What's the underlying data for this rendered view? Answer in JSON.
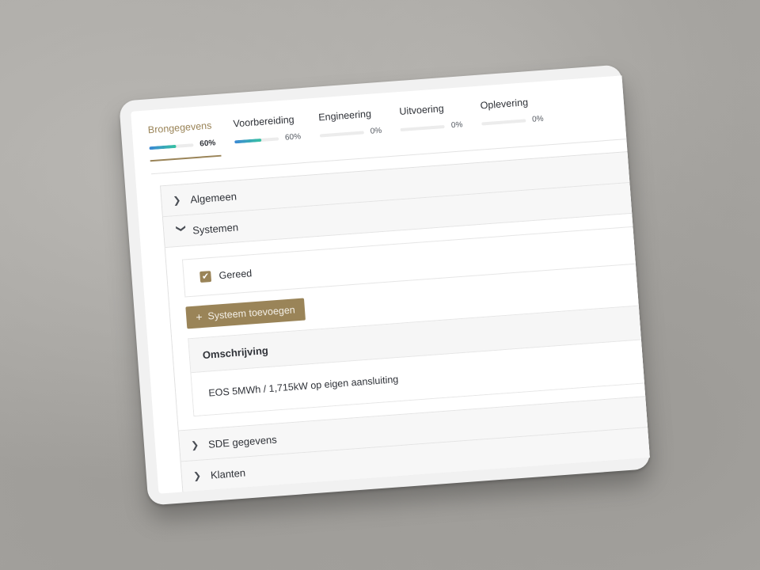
{
  "tabs": [
    {
      "label": "Brongegevens",
      "progress": 60,
      "progress_text": "60%",
      "active": true
    },
    {
      "label": "Voorbereiding",
      "progress": 60,
      "progress_text": "60%",
      "active": false
    },
    {
      "label": "Engineering",
      "progress": 0,
      "progress_text": "0%",
      "active": false
    },
    {
      "label": "Uitvoering",
      "progress": 0,
      "progress_text": "0%",
      "active": false
    },
    {
      "label": "Oplevering",
      "progress": 0,
      "progress_text": "0%",
      "active": false
    }
  ],
  "accordion": {
    "algemeen": {
      "title": "Algemeen",
      "expanded": false
    },
    "systemen": {
      "title": "Systemen",
      "expanded": true,
      "ready_label": "Gereed",
      "ready_checked": true,
      "add_button_label": "Systeem toevoegen",
      "table": {
        "header": "Omschrijving",
        "rows": [
          "EOS 5MWh / 1,715kW op eigen aansluiting"
        ]
      }
    },
    "sde": {
      "title": "SDE gegevens",
      "expanded": false
    },
    "klanten": {
      "title": "Klanten",
      "expanded": false
    }
  },
  "icons": {
    "collapsed": "chevron-right-icon",
    "expanded": "chevron-down-icon",
    "check": "check-icon",
    "add": "plus-icon"
  },
  "colors": {
    "accent": "#9a8458",
    "progress_start": "#3b88d6",
    "progress_end": "#36c2a1"
  }
}
